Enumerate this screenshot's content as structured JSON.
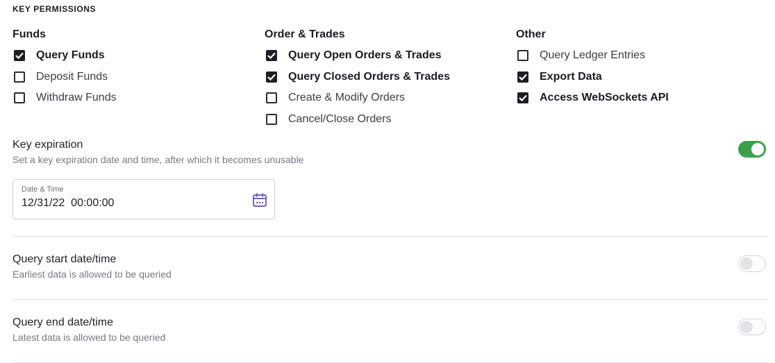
{
  "section_title": "KEY PERMISSIONS",
  "permissions": {
    "funds": {
      "heading": "Funds",
      "items": [
        {
          "label": "Query Funds",
          "checked": true
        },
        {
          "label": "Deposit Funds",
          "checked": false
        },
        {
          "label": "Withdraw Funds",
          "checked": false
        }
      ]
    },
    "orders": {
      "heading": "Order & Trades",
      "items": [
        {
          "label": "Query Open Orders & Trades",
          "checked": true
        },
        {
          "label": "Query Closed Orders & Trades",
          "checked": true
        },
        {
          "label": "Create & Modify Orders",
          "checked": false
        },
        {
          "label": "Cancel/Close Orders",
          "checked": false
        }
      ]
    },
    "other": {
      "heading": "Other",
      "items": [
        {
          "label": "Query Ledger Entries",
          "checked": false
        },
        {
          "label": "Export Data",
          "checked": true
        },
        {
          "label": "Access WebSockets API",
          "checked": true
        }
      ]
    }
  },
  "key_expiration": {
    "title": "Key expiration",
    "description": "Set a key expiration date and time, after which it becomes unusable",
    "enabled": true,
    "field_label": "Date & Time",
    "field_value": "12/31/22  00:00:00",
    "icon": "calendar-icon"
  },
  "query_start": {
    "title": "Query start date/time",
    "description": "Earliest data is allowed to be queried",
    "enabled": false
  },
  "query_end": {
    "title": "Query end date/time",
    "description": "Latest data is allowed to be queried",
    "enabled": false
  },
  "colors": {
    "toggle_on": "#3aa14a",
    "calendar_icon": "#5b4fc4",
    "checkbox_checked": "#1f1e25"
  }
}
